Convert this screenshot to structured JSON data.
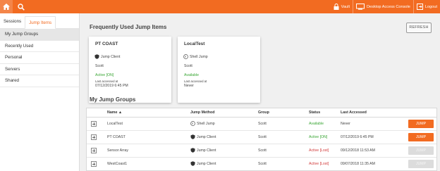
{
  "colors": {
    "accent": "#f26b21",
    "status_green": "#3aa635",
    "status_red": "#d23b3b"
  },
  "topbar": {
    "home_icon": "home-icon",
    "search_icon": "search-icon",
    "vault_label": "Vault",
    "desktop_console_label": "Desktop Access Console",
    "logout_label": "Logout"
  },
  "sidebar": {
    "tabs": [
      {
        "label": "Sessions"
      },
      {
        "label": "Jump Items"
      }
    ],
    "items": [
      {
        "label": "My Jump Groups"
      },
      {
        "label": "Recently Used"
      },
      {
        "label": "Personal"
      },
      {
        "label": "Servers"
      },
      {
        "label": "Shared"
      }
    ]
  },
  "main": {
    "frequent_title": "Frequently Used Jump Items",
    "refresh_label": "REFRESH",
    "cards": [
      {
        "title": "PT COAST",
        "method": "Jump Client",
        "user": "Scott",
        "status": "Active [ON]",
        "accessed_label": "Last accessed at",
        "accessed": "07/12/2019 6:45 PM"
      },
      {
        "title": "LocalTest",
        "method": "Shell Jump",
        "user": "Scott",
        "status": "Available",
        "accessed_label": "Last accessed at",
        "accessed": "Never"
      }
    ],
    "groups_title": "My Jump Groups",
    "table": {
      "headers": {
        "name": "Name ▲",
        "method": "Jump Method",
        "group": "Group",
        "status": "Status",
        "accessed": "Last Accessed"
      },
      "rows": [
        {
          "name": "LocalTest",
          "method": "Shell Jump",
          "group": "Scott",
          "status": "Available",
          "accessed": "Never",
          "jump": "JUMP"
        },
        {
          "name": "PT COAST",
          "method": "Jump Client",
          "group": "Scott",
          "status": "Active [ON]",
          "accessed": "07/12/2019 6:45 PM",
          "jump": "JUMP"
        },
        {
          "name": "Sensor Array",
          "method": "Jump Client",
          "group": "Scott",
          "status": "Active [Lost]",
          "accessed": "09/12/2018 11:53 AM",
          "jump": "JUMP"
        },
        {
          "name": "WestCoast1",
          "method": "Jump Client",
          "group": "Scott",
          "status": "Active [Lost]",
          "accessed": "09/07/2018 11:35 AM",
          "jump": "JUMP"
        }
      ]
    }
  }
}
